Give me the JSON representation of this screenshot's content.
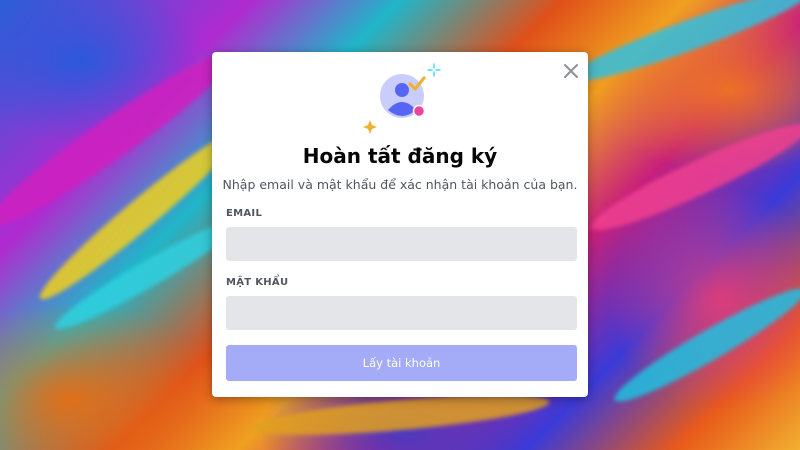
{
  "modal": {
    "title": "Hoàn tất đăng ký",
    "subtitle": "Nhập email và mật khẩu để xác nhận tài khoản của bạn.",
    "close_icon": "close-icon",
    "illustration_icon": "user-avatar-check-icon"
  },
  "form": {
    "email_label": "EMAIL",
    "email_value": "",
    "password_label": "MẬT KHẨU",
    "password_value": "",
    "submit_label": "Lấy tài khoản"
  },
  "colors": {
    "button": "#a4abf7",
    "input_bg": "#e3e5e8",
    "avatar_blue": "#5865f2",
    "check_gold": "#f0b232",
    "badge_pink": "#eb459e",
    "sparkle_blue": "#45ddf0"
  }
}
